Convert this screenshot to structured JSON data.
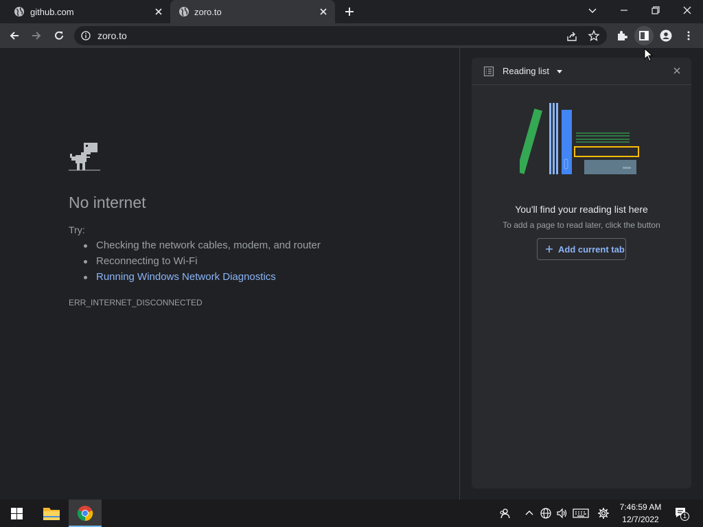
{
  "tabs": [
    {
      "title": "github.com",
      "active": false
    },
    {
      "title": "zoro.to",
      "active": true
    }
  ],
  "omnibox": {
    "url": "zoro.to"
  },
  "error_page": {
    "title": "No internet",
    "try_label": "Try:",
    "suggestions": [
      "Checking the network cables, modem, and router",
      "Reconnecting to Wi-Fi",
      "Running Windows Network Diagnostics"
    ],
    "error_code": "ERR_INTERNET_DISCONNECTED"
  },
  "side_panel": {
    "header_label": "Reading list",
    "empty_title": "You'll find your reading list here",
    "empty_subtitle": "To add a page to read later, click the button",
    "add_button_label": "Add current tab"
  },
  "taskbar": {
    "time": "7:46:59 AM",
    "date": "12/7/2022",
    "notification_count": "1"
  },
  "colors": {
    "background": "#202124",
    "toolbar": "#35363a",
    "link": "#8ab4f8",
    "muted_text": "#9aa0a6"
  }
}
